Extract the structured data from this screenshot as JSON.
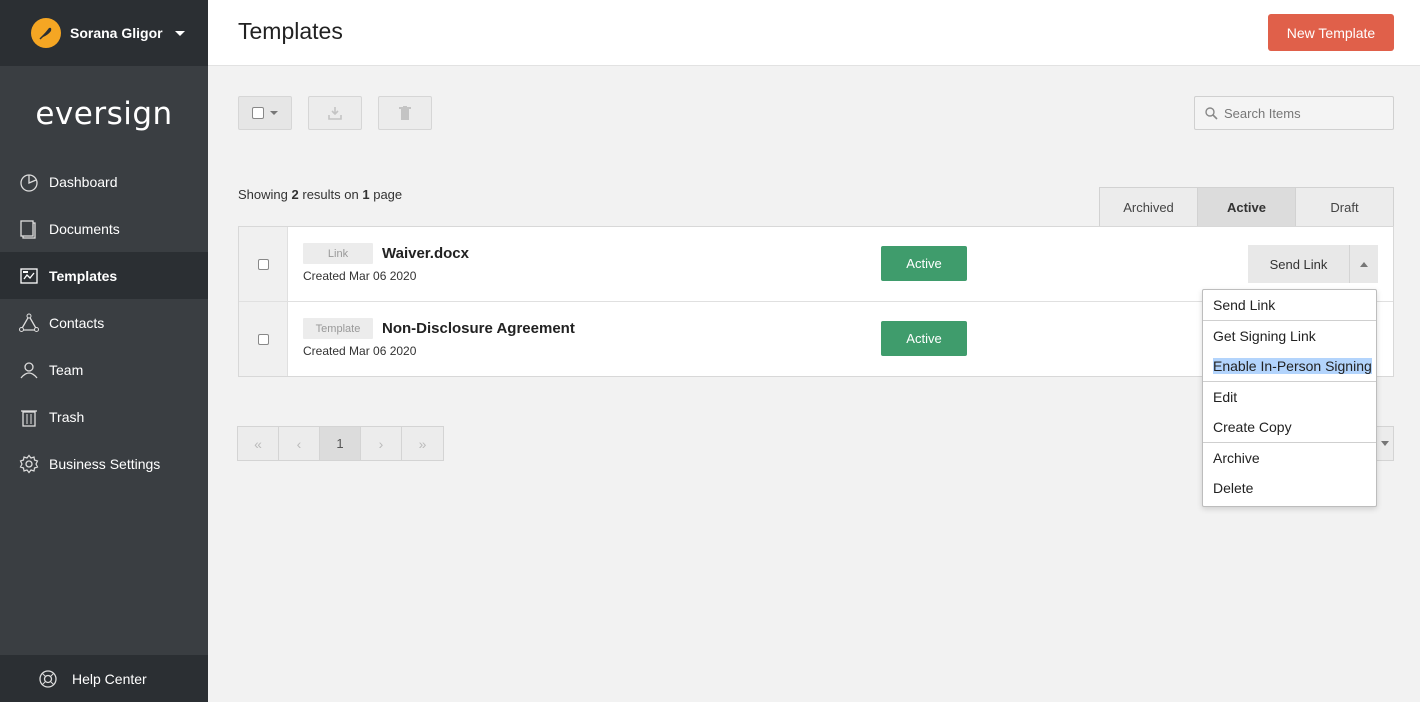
{
  "user": {
    "name": "Sorana Gligor"
  },
  "brand": {
    "logo_text": "eversign"
  },
  "nav": {
    "items": [
      {
        "label": "Dashboard",
        "icon": "dashboard-icon"
      },
      {
        "label": "Documents",
        "icon": "documents-icon"
      },
      {
        "label": "Templates",
        "icon": "templates-icon",
        "active": true
      },
      {
        "label": "Contacts",
        "icon": "contacts-icon"
      },
      {
        "label": "Team",
        "icon": "team-icon"
      },
      {
        "label": "Trash",
        "icon": "trash-icon"
      },
      {
        "label": "Business Settings",
        "icon": "gear-icon"
      }
    ],
    "help": "Help Center"
  },
  "header": {
    "title": "Templates",
    "new_button": "New Template"
  },
  "search": {
    "placeholder": "Search Items"
  },
  "results": {
    "prefix": "Showing",
    "count": "2",
    "middle": "results on",
    "pages": "1",
    "suffix": "page"
  },
  "filters": {
    "archived": "Archived",
    "active": "Active",
    "draft": "Draft"
  },
  "rows": [
    {
      "type": "Link",
      "name": "Waiver.docx",
      "created": "Created Mar 06 2020",
      "status": "Active",
      "action": "Send Link"
    },
    {
      "type": "Template",
      "name": "Non-Disclosure Agreement",
      "created": "Created Mar 06 2020",
      "status": "Active"
    }
  ],
  "pagination": {
    "first": "«",
    "prev": "‹",
    "current": "1",
    "next": "›",
    "last": "»"
  },
  "dropdown": {
    "send_link": "Send Link",
    "get_signing_link": "Get Signing Link",
    "enable_in_person": "Enable In-Person Signing",
    "edit": "Edit",
    "create_copy": "Create Copy",
    "archive": "Archive",
    "delete": "Delete"
  },
  "colors": {
    "accent": "#e0604a",
    "status_active": "#3f9c6c",
    "sidebar": "#3a3e42",
    "sidebar_dark": "#2b2f33",
    "avatar": "#f5a623"
  }
}
